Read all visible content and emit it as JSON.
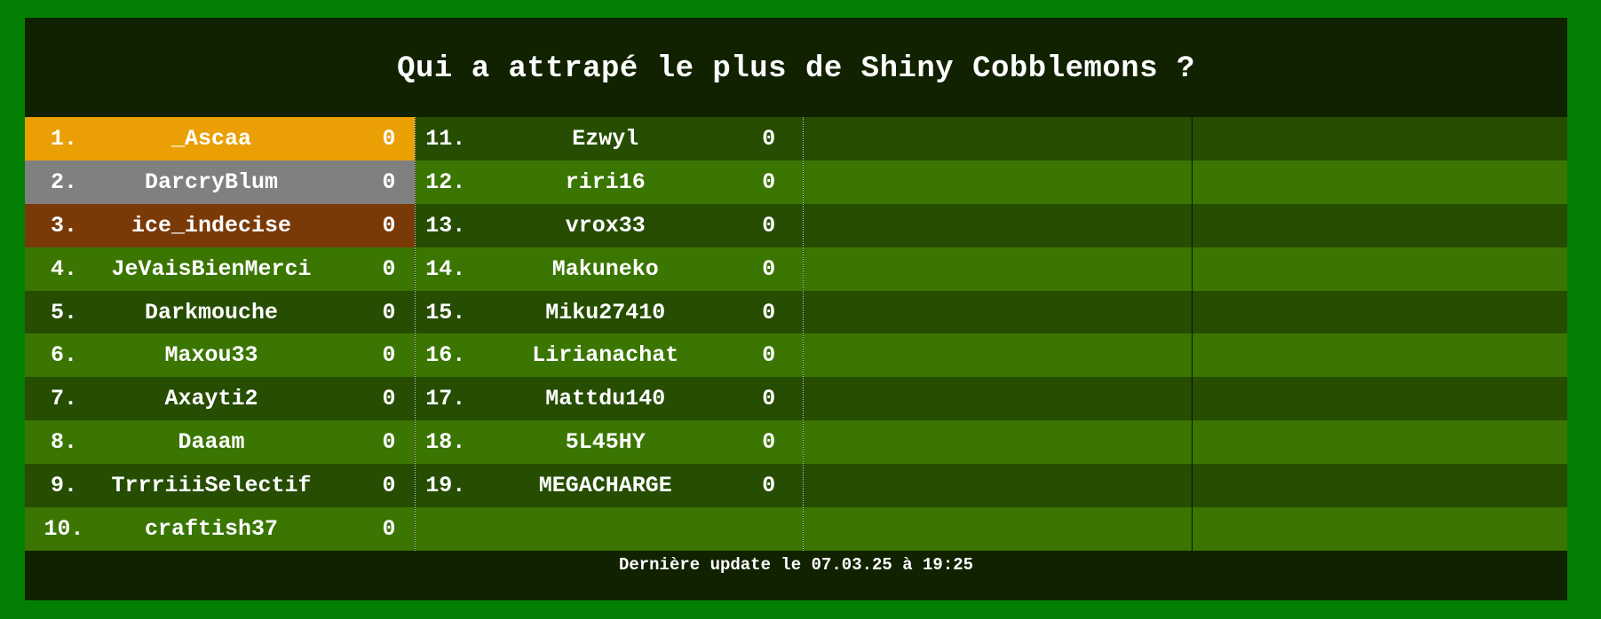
{
  "title": "Qui a attrapé le plus de Shiny Cobblemons ?",
  "footer": "Dernière update le 07.03.25 à 19:25",
  "colors": {
    "frame": "#038003",
    "board": "#112200",
    "row_dark": "#264d02",
    "row_light": "#3a7601",
    "first": "#eaa005",
    "second": "#808080",
    "third": "#7a3a08"
  },
  "column1": [
    {
      "rank": "1.",
      "name": "_Ascaa",
      "score": "0"
    },
    {
      "rank": "2.",
      "name": "DarcryBlum",
      "score": "0"
    },
    {
      "rank": "3.",
      "name": "ice_indecise",
      "score": "0"
    },
    {
      "rank": "4.",
      "name": "JeVaisBienMerci",
      "score": "0"
    },
    {
      "rank": "5.",
      "name": "Darkmouche",
      "score": "0"
    },
    {
      "rank": "6.",
      "name": "Maxou33",
      "score": "0"
    },
    {
      "rank": "7.",
      "name": "Axayti2",
      "score": "0"
    },
    {
      "rank": "8.",
      "name": "Daaam",
      "score": "0"
    },
    {
      "rank": "9.",
      "name": "TrrriiiSelectif",
      "score": "0"
    },
    {
      "rank": "10.",
      "name": "craftish37",
      "score": "0"
    }
  ],
  "column2": [
    {
      "rank": "11.",
      "name": "Ezwyl",
      "score": "0"
    },
    {
      "rank": "12.",
      "name": "riri16",
      "score": "0"
    },
    {
      "rank": "13.",
      "name": "vrox33",
      "score": "0"
    },
    {
      "rank": "14.",
      "name": "Makuneko",
      "score": "0"
    },
    {
      "rank": "15.",
      "name": "Miku27410",
      "score": "0"
    },
    {
      "rank": "16.",
      "name": "Lirianachat",
      "score": "0"
    },
    {
      "rank": "17.",
      "name": "Mattdu140",
      "score": "0"
    },
    {
      "rank": "18.",
      "name": "5L45HY",
      "score": "0"
    },
    {
      "rank": "19.",
      "name": "MEGACHARGE",
      "score": "0"
    }
  ]
}
